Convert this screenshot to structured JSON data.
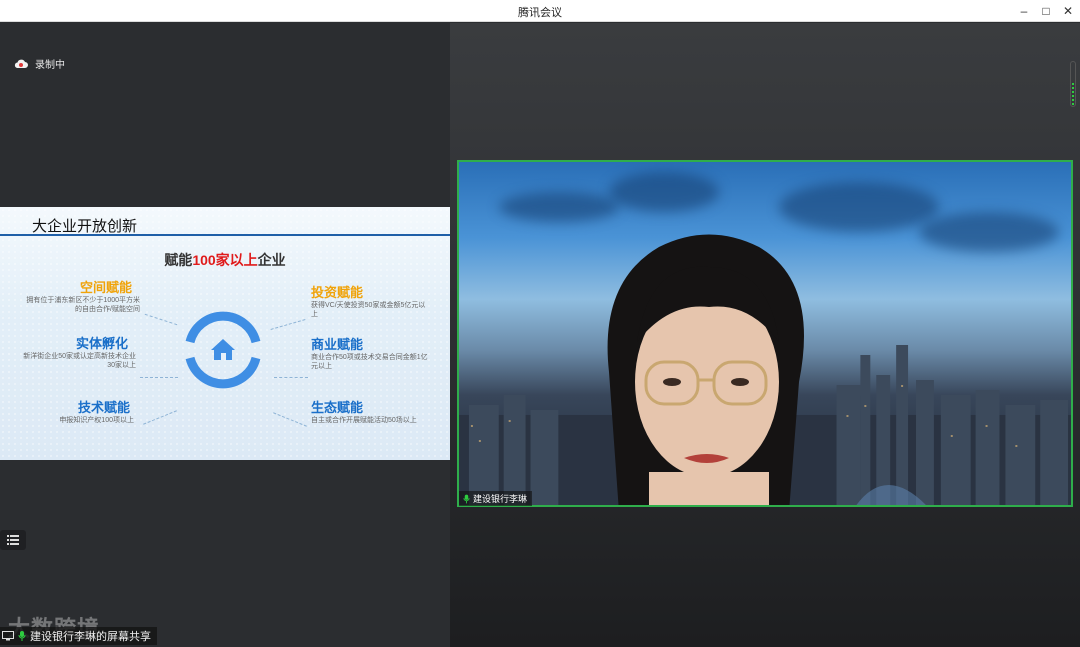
{
  "window": {
    "title": "腾讯会议"
  },
  "recording": {
    "label": "录制中"
  },
  "slide": {
    "title": "大企业开放创新",
    "headline_pre": "赋能",
    "headline_red": "100家以上",
    "headline_post": "企业",
    "features": [
      {
        "title": "空间赋能",
        "desc": "拥有位于浦东新区不少于1000平方米的自由合作/赋能空间"
      },
      {
        "title": "实体孵化",
        "desc": "新洋街企业50家或认定高新技术企业30家以上"
      },
      {
        "title": "技术赋能",
        "desc": "申报知识产权100项以上"
      },
      {
        "title": "投资赋能",
        "desc": "获得VC/天使投资50家或金额5亿元以上"
      },
      {
        "title": "商业赋能",
        "desc": "商业合作50项或技术交易合同金额1亿元以上"
      },
      {
        "title": "生态赋能",
        "desc": "自主或合作开展赋能活动50场以上"
      }
    ]
  },
  "watermark": "大数跨境",
  "share_label": "建设银行李琳的屏幕共享",
  "video": {
    "name": "建设银行李琳"
  },
  "colors": {
    "accent_green": "#2fae4b",
    "slide_blue": "#1f5fa8",
    "gold": "#f0a30a"
  }
}
